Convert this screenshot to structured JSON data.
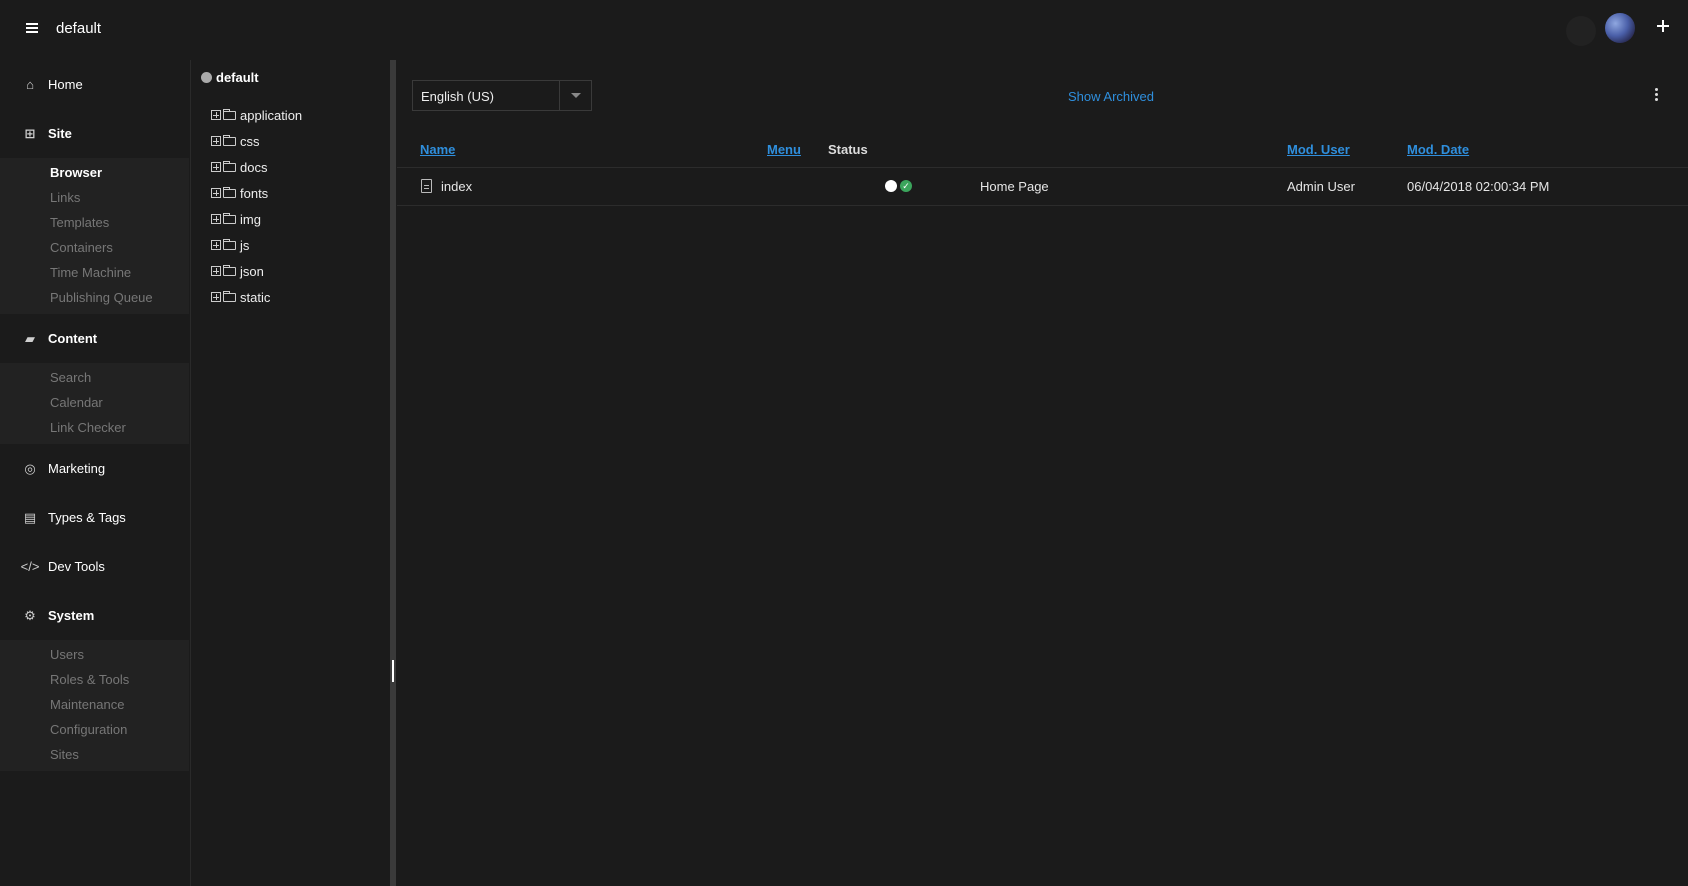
{
  "app": {
    "title": "default"
  },
  "nav": {
    "sections": [
      {
        "label": "Home",
        "icon": "home-icon",
        "items": []
      },
      {
        "label": "Site",
        "icon": "sitemap-icon",
        "items": [
          {
            "label": "Browser",
            "active": true
          },
          {
            "label": "Links"
          },
          {
            "label": "Templates"
          },
          {
            "label": "Containers"
          },
          {
            "label": "Time Machine"
          },
          {
            "label": "Publishing Queue"
          }
        ]
      },
      {
        "label": "Content",
        "icon": "folder-open-icon",
        "items": [
          {
            "label": "Search"
          },
          {
            "label": "Calendar"
          },
          {
            "label": "Link Checker"
          }
        ]
      },
      {
        "label": "Marketing",
        "icon": "target-icon",
        "items": []
      },
      {
        "label": "Types & Tags",
        "icon": "file-text-icon",
        "items": []
      },
      {
        "label": "Dev Tools",
        "icon": "code-icon",
        "items": []
      },
      {
        "label": "System",
        "icon": "gear-icon",
        "items": [
          {
            "label": "Users"
          },
          {
            "label": "Roles & Tools"
          },
          {
            "label": "Maintenance"
          },
          {
            "label": "Configuration"
          },
          {
            "label": "Sites"
          }
        ]
      }
    ]
  },
  "tree": {
    "root": "default",
    "folders": [
      "application",
      "css",
      "docs",
      "fonts",
      "img",
      "js",
      "json",
      "static"
    ]
  },
  "main": {
    "language": "English (US)",
    "show_archived": "Show Archived",
    "columns": {
      "name": "Name",
      "menu": "Menu",
      "status": "Status",
      "mod_user": "Mod. User",
      "mod_date": "Mod. Date"
    },
    "rows": [
      {
        "name": "index",
        "title": "Home Page",
        "mod_user": "Admin User",
        "mod_date": "06/04/2018 02:00:34 PM"
      }
    ]
  },
  "colors": {
    "accent": "#2f8fdd",
    "status_green": "#3ba55c",
    "background": "#1b1b1b"
  }
}
